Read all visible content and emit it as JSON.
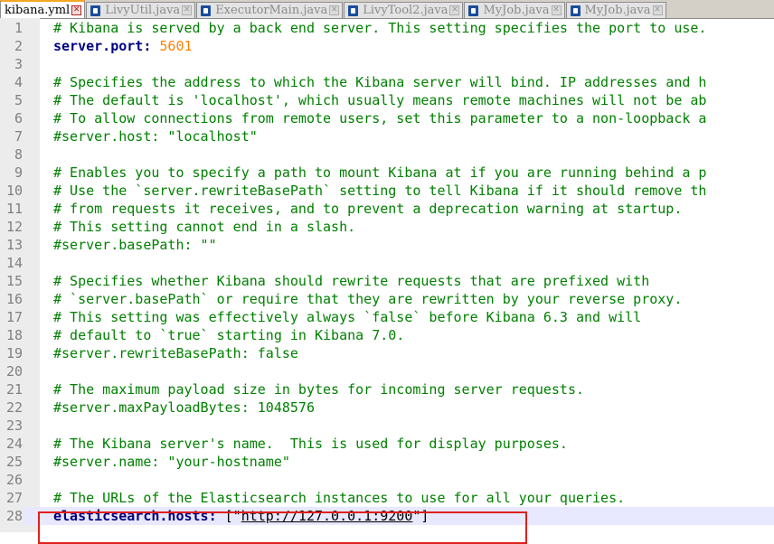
{
  "tabs": [
    {
      "label": "kibana.yml",
      "active": true,
      "icon": "file-icon"
    },
    {
      "label": "LivyUtil.java",
      "active": false,
      "icon": "file-icon"
    },
    {
      "label": "ExecutorMain.java",
      "active": false,
      "icon": "file-icon"
    },
    {
      "label": "LivyTool2.java",
      "active": false,
      "icon": "file-icon"
    },
    {
      "label": "MyJob.java",
      "active": false,
      "icon": "file-icon"
    },
    {
      "label": "MyJob.java",
      "active": false,
      "icon": "file-icon"
    }
  ],
  "close_glyph": "✕",
  "lines": [
    {
      "n": "1",
      "parts": [
        {
          "t": "# Kibana is served by a back end server. This setting specifies the port to use.",
          "c": "comment"
        }
      ]
    },
    {
      "n": "2",
      "parts": [
        {
          "t": "server.port:",
          "c": "key"
        },
        {
          "t": " ",
          "c": "plain"
        },
        {
          "t": "5601",
          "c": "number"
        }
      ]
    },
    {
      "n": "3",
      "parts": []
    },
    {
      "n": "4",
      "parts": [
        {
          "t": "# Specifies the address to which the Kibana server will bind. IP addresses and h",
          "c": "comment"
        }
      ]
    },
    {
      "n": "5",
      "parts": [
        {
          "t": "# The default is 'localhost', which usually means remote machines will not be ab",
          "c": "comment"
        }
      ]
    },
    {
      "n": "6",
      "parts": [
        {
          "t": "# To allow connections from remote users, set this parameter to a non-loopback a",
          "c": "comment"
        }
      ]
    },
    {
      "n": "7",
      "parts": [
        {
          "t": "#server.host: \"localhost\"",
          "c": "comment"
        }
      ]
    },
    {
      "n": "8",
      "parts": []
    },
    {
      "n": "9",
      "parts": [
        {
          "t": "# Enables you to specify a path to mount Kibana at if you are running behind a p",
          "c": "comment"
        }
      ]
    },
    {
      "n": "10",
      "parts": [
        {
          "t": "# Use the `server.rewriteBasePath` setting to tell Kibana if it should remove th",
          "c": "comment"
        }
      ]
    },
    {
      "n": "11",
      "parts": [
        {
          "t": "# from requests it receives, and to prevent a deprecation warning at startup.",
          "c": "comment"
        }
      ]
    },
    {
      "n": "12",
      "parts": [
        {
          "t": "# This setting cannot end in a slash.",
          "c": "comment"
        }
      ]
    },
    {
      "n": "13",
      "parts": [
        {
          "t": "#server.basePath: \"\"",
          "c": "comment"
        }
      ]
    },
    {
      "n": "14",
      "parts": []
    },
    {
      "n": "15",
      "parts": [
        {
          "t": "# Specifies whether Kibana should rewrite requests that are prefixed with",
          "c": "comment"
        }
      ]
    },
    {
      "n": "16",
      "parts": [
        {
          "t": "# `server.basePath` or require that they are rewritten by your reverse proxy.",
          "c": "comment"
        }
      ]
    },
    {
      "n": "17",
      "parts": [
        {
          "t": "# This setting was effectively always `false` before Kibana 6.3 and will",
          "c": "comment"
        }
      ]
    },
    {
      "n": "18",
      "parts": [
        {
          "t": "# default to `true` starting in Kibana 7.0.",
          "c": "comment"
        }
      ]
    },
    {
      "n": "19",
      "parts": [
        {
          "t": "#server.rewriteBasePath: false",
          "c": "comment"
        }
      ]
    },
    {
      "n": "20",
      "parts": []
    },
    {
      "n": "21",
      "parts": [
        {
          "t": "# The maximum payload size in bytes for incoming server requests.",
          "c": "comment"
        }
      ]
    },
    {
      "n": "22",
      "parts": [
        {
          "t": "#server.maxPayloadBytes: 1048576",
          "c": "comment"
        }
      ]
    },
    {
      "n": "23",
      "parts": []
    },
    {
      "n": "24",
      "parts": [
        {
          "t": "# The Kibana server's name.  This is used for display purposes.",
          "c": "comment"
        }
      ]
    },
    {
      "n": "25",
      "parts": [
        {
          "t": "#server.name: \"your-hostname\"",
          "c": "comment"
        }
      ]
    },
    {
      "n": "26",
      "parts": []
    },
    {
      "n": "27",
      "parts": [
        {
          "t": "# The URLs of the Elasticsearch instances to use for all your queries.",
          "c": "comment"
        }
      ]
    },
    {
      "n": "28",
      "current": true,
      "parts": [
        {
          "t": "elasticsearch.hosts:",
          "c": "key"
        },
        {
          "t": " [\"",
          "c": "plain"
        },
        {
          "t": "http://127.0.0.1:9200",
          "c": "link"
        },
        {
          "t": "\"]",
          "c": "plain"
        }
      ]
    }
  ],
  "colors": {
    "comment": "#008000",
    "key": "#000080",
    "number": "#ff8000",
    "current_line": "#e8e8ff",
    "highlight_border": "#e0201a",
    "active_tab_accent": "#f5a623"
  }
}
